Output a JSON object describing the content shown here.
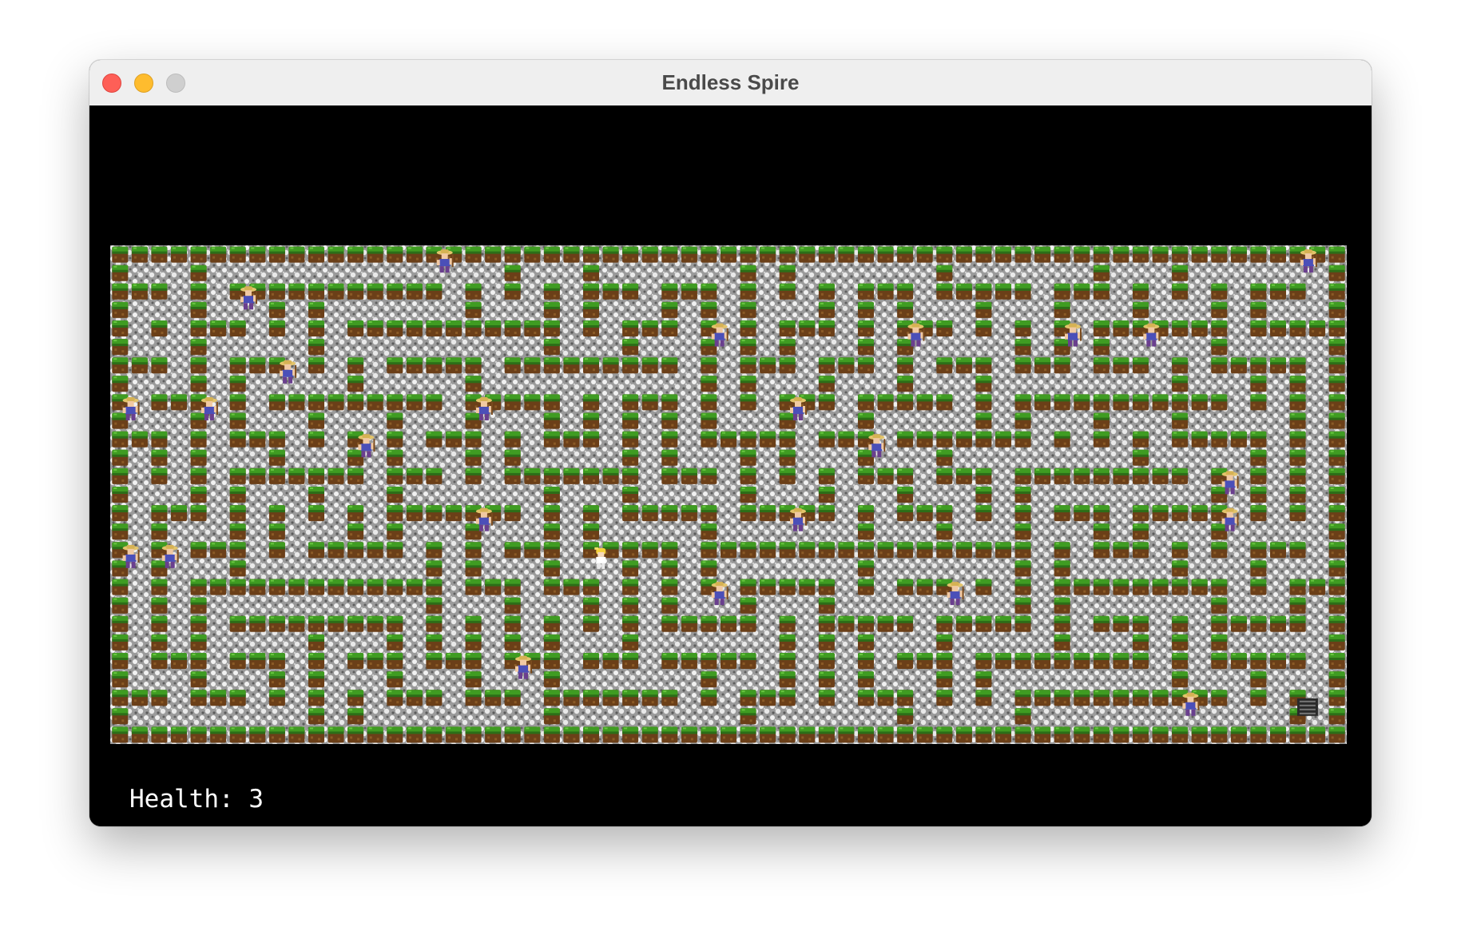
{
  "window": {
    "title": "Endless Spire"
  },
  "hud": {
    "health_label": "Health:",
    "health_value": "3"
  },
  "icons": {
    "close": "close-button",
    "minimize": "minimize-button",
    "maximize": "maximize-button",
    "wall": "grass-dirt-block-icon",
    "floor": "gravel-floor-texture",
    "player": "blonde-hero-icon",
    "enemy": "straw-hat-farmer-icon",
    "exit": "stairs-down-icon"
  },
  "colors": {
    "background": "#000000",
    "grass": "#3e9a22",
    "dirt": "#7a4b1e",
    "floor_light": "#d9d9d9",
    "floor_dark": "#7d7d7d",
    "hud_text": "#ffffff"
  },
  "maze": {
    "cols": 31,
    "rows": 13,
    "seed": 7,
    "player_cell": [
      12,
      8
    ],
    "exit_cell": [
      30,
      12
    ],
    "enemy_cells": [
      [
        3,
        1
      ],
      [
        8,
        0
      ],
      [
        15,
        2
      ],
      [
        20,
        2
      ],
      [
        24,
        2
      ],
      [
        26,
        2
      ],
      [
        31,
        0
      ],
      [
        2,
        4
      ],
      [
        9,
        4
      ],
      [
        17,
        4
      ],
      [
        0,
        4
      ],
      [
        6,
        5
      ],
      [
        19,
        5
      ],
      [
        28,
        6
      ],
      [
        9,
        7
      ],
      [
        17,
        7
      ],
      [
        28,
        7
      ],
      [
        0,
        8
      ],
      [
        1,
        8
      ],
      [
        15,
        9
      ],
      [
        21,
        9
      ],
      [
        10,
        11
      ],
      [
        27,
        12
      ],
      [
        4,
        3
      ]
    ]
  }
}
